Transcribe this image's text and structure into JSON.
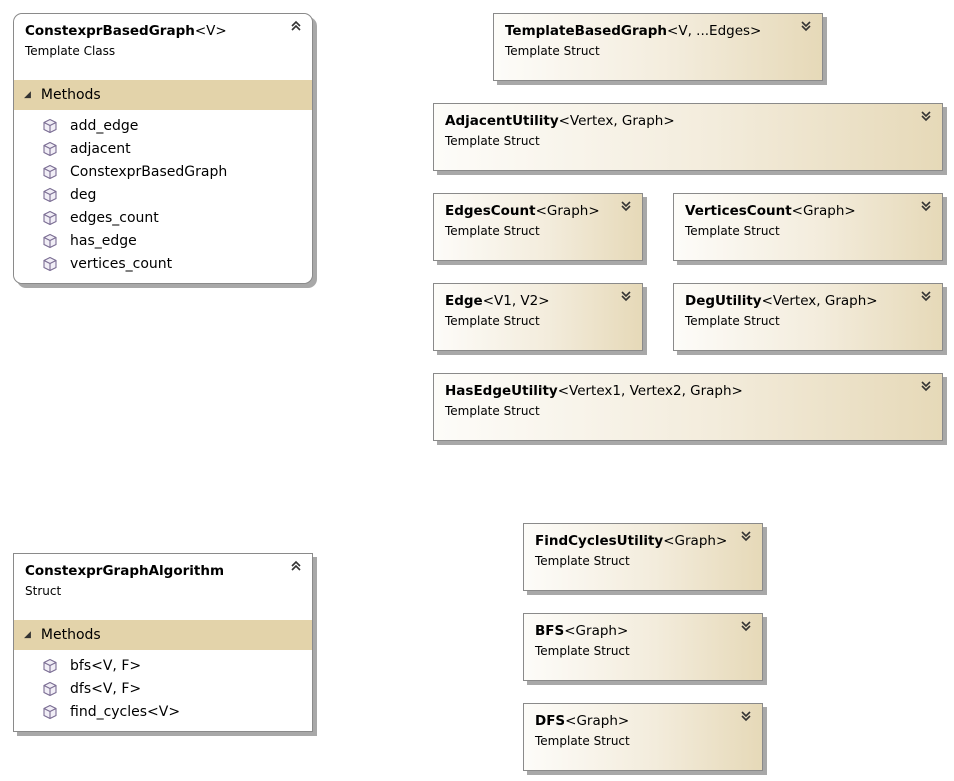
{
  "nodes": {
    "constexpr_based_graph": {
      "title_bold": "ConstexprBasedGraph",
      "title_rest": "<V>",
      "kind": "Template Class",
      "collapse_glyph": "⌃⌃",
      "section": "Methods",
      "methods": [
        "add_edge",
        "adjacent",
        "ConstexprBasedGraph",
        "deg",
        "edges_count",
        "has_edge",
        "vertices_count"
      ]
    },
    "constexpr_graph_algorithm": {
      "title_bold": "ConstexprGraphAlgorithm",
      "title_rest": "",
      "kind": "Struct",
      "collapse_glyph": "⌃⌃",
      "section": "Methods",
      "methods": [
        "bfs<V, F>",
        "dfs<V, F>",
        "find_cycles<V>"
      ]
    },
    "template_based_graph": {
      "title_bold": "TemplateBasedGraph",
      "title_rest": "<V, ...Edges>",
      "kind": "Template Struct"
    },
    "adjacent_utility": {
      "title_bold": "AdjacentUtility",
      "title_rest": "<Vertex, Graph>",
      "kind": "Template Struct"
    },
    "edges_count": {
      "title_bold": "EdgesCount",
      "title_rest": "<Graph>",
      "kind": "Template Struct"
    },
    "vertices_count": {
      "title_bold": "VerticesCount",
      "title_rest": "<Graph>",
      "kind": "Template Struct"
    },
    "edge": {
      "title_bold": "Edge",
      "title_rest": "<V1, V2>",
      "kind": "Template Struct"
    },
    "deg_utility": {
      "title_bold": "DegUtility",
      "title_rest": "<Vertex, Graph>",
      "kind": "Template Struct"
    },
    "has_edge_utility": {
      "title_bold": "HasEdgeUtility",
      "title_rest": "<Vertex1, Vertex2, Graph>",
      "kind": "Template Struct"
    },
    "find_cycles_utility": {
      "title_bold": "FindCyclesUtility",
      "title_rest": "<Graph>",
      "kind": "Template Struct"
    },
    "bfs": {
      "title_bold": "BFS",
      "title_rest": "<Graph>",
      "kind": "Template Struct"
    },
    "dfs": {
      "title_bold": "DFS",
      "title_rest": "<Graph>",
      "kind": "Template Struct"
    }
  },
  "icons": {
    "method": "method-cube-icon",
    "expand": "chevron-double-down-icon",
    "collapse": "chevron-double-up-icon",
    "section": "triangle-collapse-icon"
  },
  "colors": {
    "header_gradient_end": "#e6d9b8",
    "section_band": "#e3d3aa",
    "border": "#8a8a8a",
    "shadow": "#a8a8a8"
  }
}
